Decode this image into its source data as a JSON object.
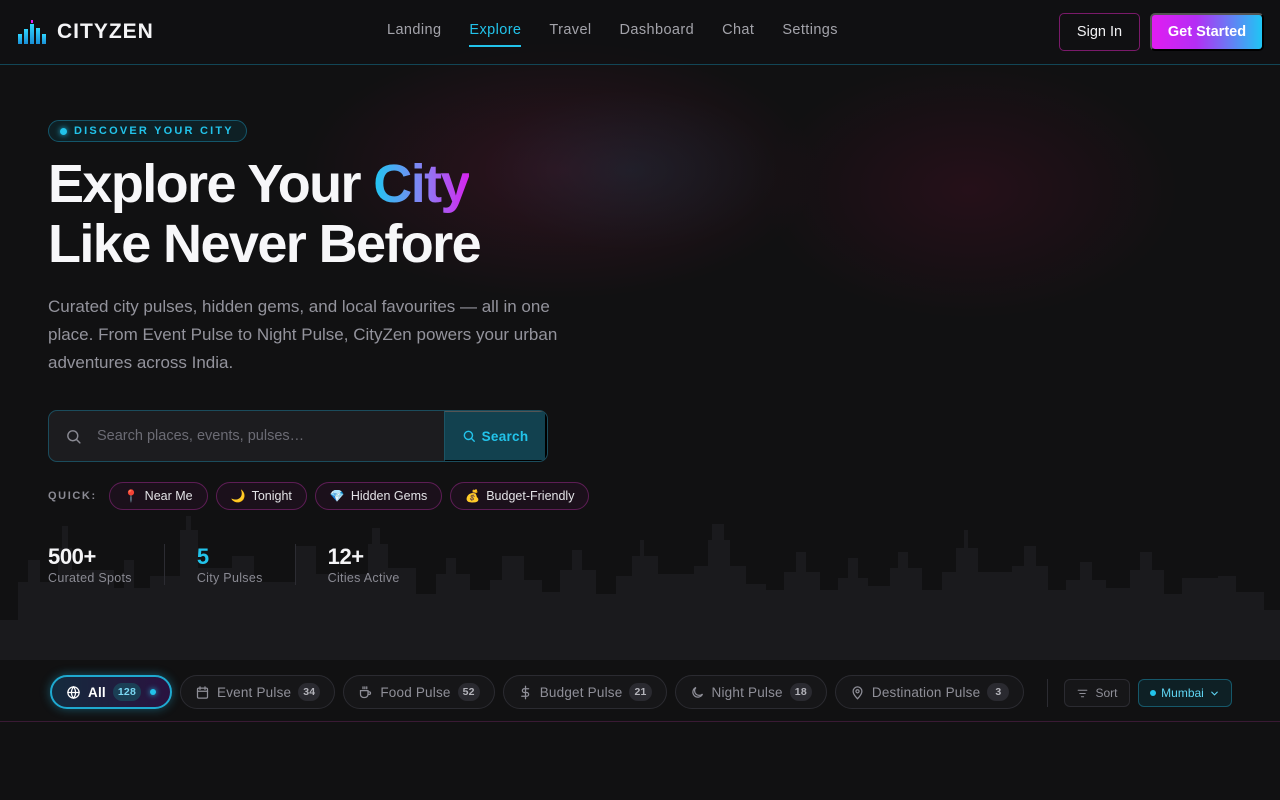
{
  "brand": {
    "name": "CITYZEN"
  },
  "nav": {
    "items": [
      {
        "label": "Landing"
      },
      {
        "label": "Explore"
      },
      {
        "label": "Travel"
      },
      {
        "label": "Dashboard"
      },
      {
        "label": "Chat"
      },
      {
        "label": "Settings"
      }
    ],
    "active": "Explore"
  },
  "header_actions": {
    "sign_in": "Sign In",
    "get_started": "Get Started"
  },
  "hero": {
    "badge": "DISCOVER YOUR CITY",
    "title_part1": "Explore Your ",
    "title_accent": "City",
    "title_line2": "Like Never Before",
    "subtitle": "Curated city pulses, hidden gems, and local favourites — all in one place. From Event Pulse to Night Pulse, CityZen powers your urban adventures across India."
  },
  "search": {
    "placeholder": "Search places, events, pulses…",
    "button": "Search"
  },
  "quick": {
    "label": "QUICK:",
    "chips": [
      {
        "emoji": "📍",
        "label": "Near Me"
      },
      {
        "emoji": "🌙",
        "label": "Tonight"
      },
      {
        "emoji": "💎",
        "label": "Hidden Gems"
      },
      {
        "emoji": "💰",
        "label": "Budget-Friendly"
      }
    ]
  },
  "stats": [
    {
      "value": "500+",
      "label": "Curated Spots"
    },
    {
      "value": "5",
      "label": "City Pulses"
    },
    {
      "value": "12+",
      "label": "Cities Active"
    }
  ],
  "filters": {
    "tabs": [
      {
        "icon": "globe-icon",
        "label": "All",
        "count": "128"
      },
      {
        "icon": "calendar-icon",
        "label": "Event Pulse",
        "count": "34"
      },
      {
        "icon": "coffee-icon",
        "label": "Food Pulse",
        "count": "52"
      },
      {
        "icon": "dollar-icon",
        "label": "Budget Pulse",
        "count": "21"
      },
      {
        "icon": "moon-icon",
        "label": "Night Pulse",
        "count": "18"
      },
      {
        "icon": "map-pin-icon",
        "label": "Destination Pulse",
        "count": "3"
      }
    ],
    "active": "All",
    "sort_label": "Sort",
    "city": "Mumbai"
  },
  "colors": {
    "accent_cyan": "#22c3ea",
    "accent_magenta": "#e11cf2",
    "background": "#111112"
  }
}
